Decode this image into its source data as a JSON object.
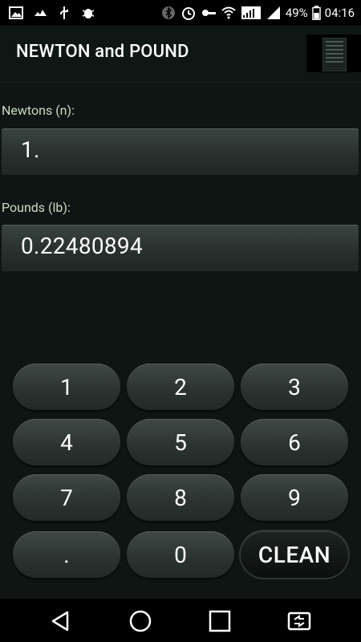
{
  "status_bar": {
    "battery_percent": "49%",
    "time": "04:16"
  },
  "app": {
    "title": "NEWTON and POUND"
  },
  "fields": {
    "newtons_label": "Newtons (n):",
    "newtons_value": "1.",
    "pounds_label": "Pounds (lb):",
    "pounds_value": "0.22480894"
  },
  "keypad": {
    "keys": [
      "1",
      "2",
      "3",
      "4",
      "5",
      "6",
      "7",
      "8",
      "9",
      ".",
      "0",
      "CLEAN"
    ]
  },
  "navigation": {
    "back": "back-icon",
    "home": "home-icon",
    "recents": "recents-icon",
    "switch": "dual-window-icon"
  }
}
